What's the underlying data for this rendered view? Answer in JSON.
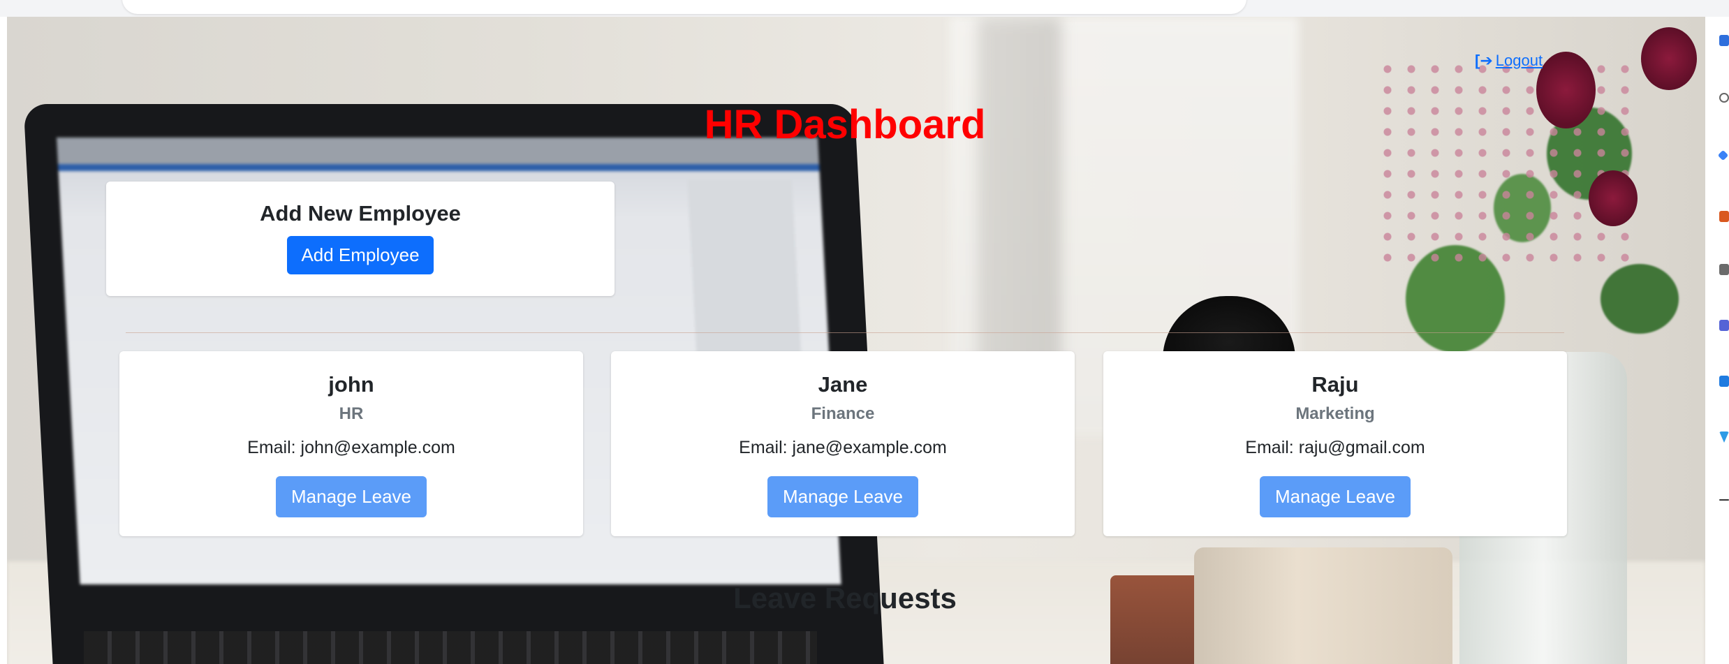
{
  "header": {
    "logout_label": "Logout",
    "title": "HR Dashboard"
  },
  "add_employee": {
    "heading": "Add New Employee",
    "button_label": "Add Employee"
  },
  "employees": [
    {
      "name": "john",
      "department": "HR",
      "email": "Email: john@example.com",
      "action_label": "Manage Leave"
    },
    {
      "name": "Jane",
      "department": "Finance",
      "email": "Email: jane@example.com",
      "action_label": "Manage Leave"
    },
    {
      "name": "Raju",
      "department": "Marketing",
      "email": "Email: raju@gmail.com",
      "action_label": "Manage Leave"
    }
  ],
  "leave_section": {
    "heading": "Leave Requests"
  },
  "colors": {
    "title": "#ff0000",
    "primary": "#0d6efd",
    "manage_button": "#5b9cf8",
    "department_text": "#6c757d"
  },
  "icons": {
    "logout": "sign-out-icon"
  }
}
